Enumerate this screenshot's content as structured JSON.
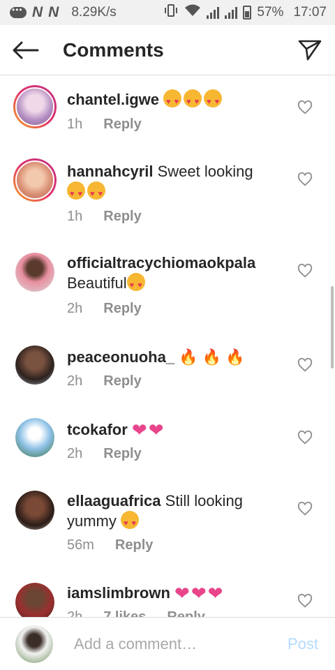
{
  "status_bar": {
    "glyph_a": "N",
    "glyph_b": "N",
    "speed": "8.29K/s",
    "battery": "57%",
    "time": "17:07"
  },
  "header": {
    "title": "Comments",
    "back_icon": "arrow-left-icon",
    "send_icon": "paper-plane-icon"
  },
  "comments": [
    {
      "username": "chantel.igwe",
      "text": "",
      "time": "1h",
      "reply": "Reply",
      "avatar_color": "#c9a9d6",
      "story_ring": true
    },
    {
      "username": "hannahcyril",
      "text": "Sweet looking",
      "time": "1h",
      "reply": "Reply",
      "avatar_color": "#e8b89a",
      "story_ring": true
    },
    {
      "username": "officialtracychiomaokpala",
      "text": "Beautiful",
      "time": "2h",
      "reply": "Reply",
      "avatar_color": "#d35b6b",
      "story_ring": false
    },
    {
      "username": "peaceonuoha_",
      "text": "",
      "time": "2h",
      "reply": "Reply",
      "avatar_color": "#4a3a33",
      "story_ring": false
    },
    {
      "username": "tcokafor",
      "text": "",
      "time": "2h",
      "reply": "Reply",
      "avatar_color": "#7fb0d8",
      "story_ring": false
    },
    {
      "username": "ellaaguafrica",
      "text": "Still looking",
      "text_line2": "yummy",
      "time": "56m",
      "reply": "Reply",
      "avatar_color": "#3b2a24",
      "story_ring": false
    },
    {
      "username": "iamslimbrown",
      "text": "",
      "time": "2h",
      "likes": "7 likes",
      "reply": "Reply",
      "avatar_color": "#8b3a3a",
      "story_ring": false
    }
  ],
  "composer": {
    "placeholder": "Add a comment…",
    "post_label": "Post",
    "avatar_color": "#6f8f5a"
  },
  "colors": {
    "accent_blue_disabled": "#b3dbff",
    "secondary_text": "#8e8e8e",
    "primary_text": "#262626"
  }
}
